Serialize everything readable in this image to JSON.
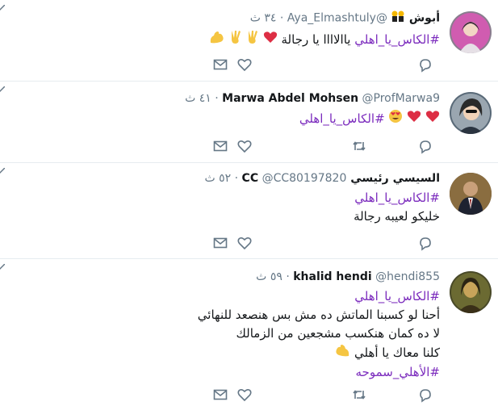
{
  "tweets": [
    {
      "name": "أبوش",
      "handle": "@Aya_Elmashtuly",
      "dot": "·",
      "time": "٣٤ ث",
      "lines": [
        {
          "hashtag": "#الكاس_يا_اهلي",
          "text": " ياالاااا يا رجالة"
        }
      ],
      "reply_count": "",
      "avatar": "avatar-1"
    },
    {
      "name": "Marwa Abdel Mohsen",
      "handle": "@ProfMarwa9",
      "dot": "·",
      "time": "٤١ ث",
      "lines": [
        {
          "hashtag": "#الكاس_يا_اهلي",
          "text": ""
        }
      ],
      "avatar": "avatar-2"
    },
    {
      "name": "السيسي رئيسي CC",
      "handle": "@CC80197820",
      "dot": "·",
      "time": "٥٢ ث",
      "lines": [
        {
          "hashtag": "#الكاس_يا_اهلي",
          "text": ""
        },
        {
          "hashtag": "",
          "text": "خليكو لعيبه رجالة"
        }
      ],
      "avatar": "avatar-3"
    },
    {
      "name": "khalid hendi",
      "handle": "@hendi855",
      "dot": "·",
      "time": "٥٩ ث",
      "lines": [
        {
          "hashtag": "#الكاس_يا_اهلي",
          "text": ""
        },
        {
          "hashtag": "",
          "text": "أحنا لو كسبنا الماتش ده مش بس هنصعد للنهائي"
        },
        {
          "hashtag": "",
          "text": "لا ده كمان هنكسب مشجعين من الزمالك"
        },
        {
          "hashtag": "",
          "text": "كلنا معاك يا أهلي"
        },
        {
          "hashtag": "#الأهلي_سموحه",
          "text": ""
        }
      ],
      "avatar": "avatar-4"
    }
  ],
  "icons": {
    "reply": "reply-icon",
    "retweet": "retweet-icon",
    "like": "heart-icon",
    "dm": "mail-icon",
    "caret": "chevron-down-icon"
  }
}
